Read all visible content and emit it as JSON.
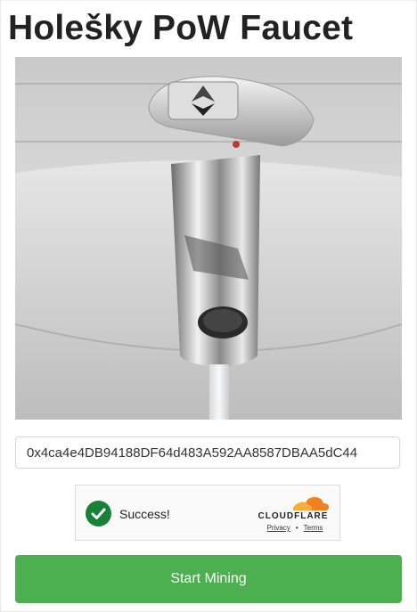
{
  "page": {
    "title": "Holešky PoW Faucet"
  },
  "hero_image": {
    "subject": "faucet-tap-with-ethereum-logo"
  },
  "address_input": {
    "value": "0x4ca4e4DB94188DF64d483A592AA8587DBAA5dC44"
  },
  "captcha": {
    "status_text": "Success!",
    "provider": "CLOUDFLARE",
    "privacy_label": "Privacy",
    "separator": "•",
    "terms_label": "Terms",
    "success_color": "#198038",
    "brand_color": "#f38020"
  },
  "actions": {
    "start_label": "Start Mining",
    "button_color": "#4cb050"
  }
}
